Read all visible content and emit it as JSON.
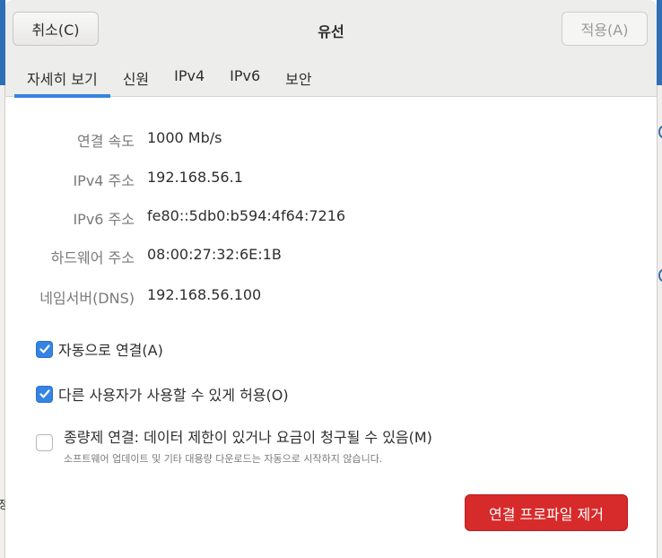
{
  "header": {
    "cancel_label": "취소(C)",
    "title": "유선",
    "apply_label": "적용(A)"
  },
  "tabs": [
    {
      "label": "자세히 보기",
      "active": true
    },
    {
      "label": "신원",
      "active": false
    },
    {
      "label": "IPv4",
      "active": false
    },
    {
      "label": "IPv6",
      "active": false
    },
    {
      "label": "보안",
      "active": false
    }
  ],
  "details": [
    {
      "label": "연결 속도",
      "value": "1000 Mb/s"
    },
    {
      "label": "IPv4 주소",
      "value": "192.168.56.1"
    },
    {
      "label": "IPv6 주소",
      "value": "fe80::5db0:b594:4f64:7216"
    },
    {
      "label": "하드웨어 주소",
      "value": "08:00:27:32:6E:1B"
    },
    {
      "label": "네임서버(DNS)",
      "value": "192.168.56.100"
    }
  ],
  "options": {
    "auto_connect": {
      "label": "자동으로 연결(A)",
      "checked": true
    },
    "all_users": {
      "label": "다른 사용자가 사용할 수 있게 허용(O)",
      "checked": true
    },
    "metered": {
      "label": "종량제 연결: 데이터 제한이 있거나 요금이 청구될 수 있음(M)",
      "description": "소프트웨어 업데이트 및 기타 대용량 다운로드는 자동으로 시작하지 않습니다.",
      "checked": false
    }
  },
  "remove_button_label": "연결 프로파일 제거",
  "colors": {
    "accent": "#3584e4",
    "destructive": "#d72a2a",
    "header_bg": "#ededeb"
  },
  "background_glyph": "정"
}
